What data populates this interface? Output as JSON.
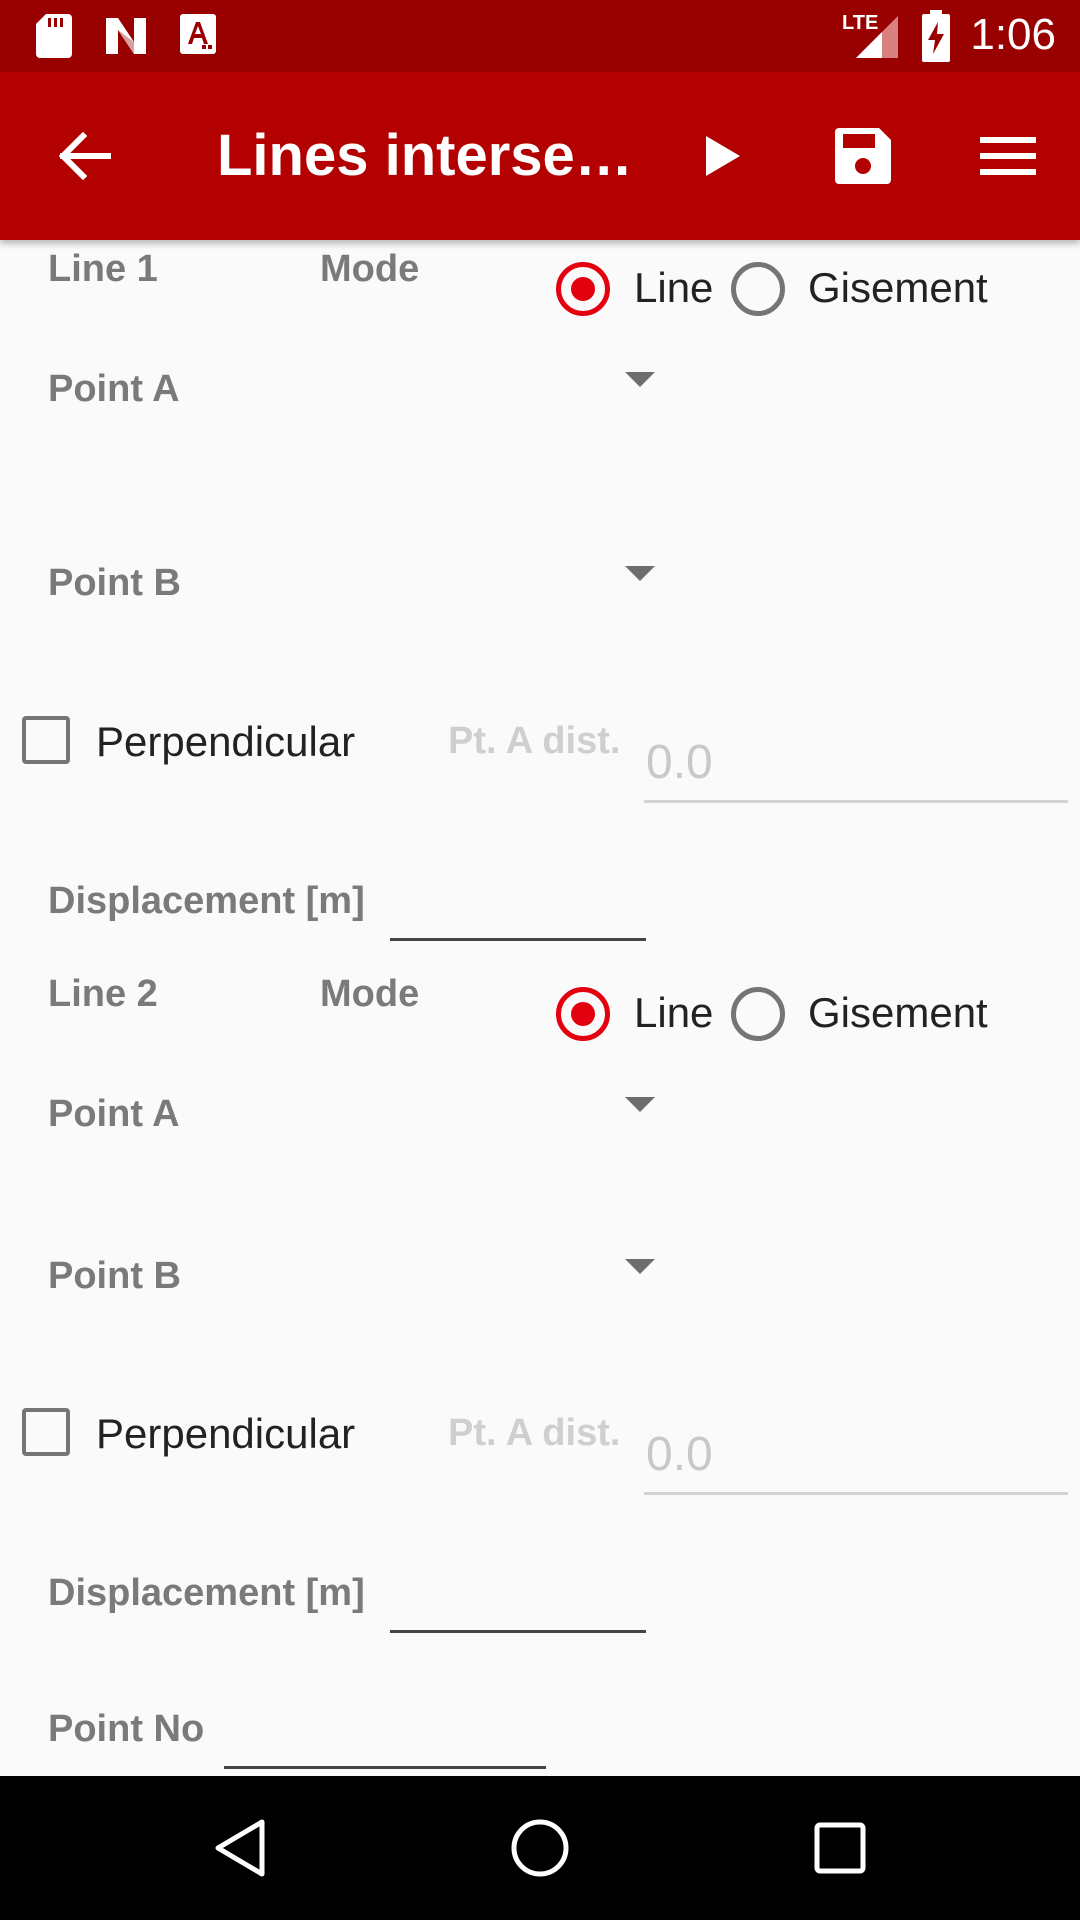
{
  "status_bar": {
    "time": "1:06",
    "network_label": "LTE",
    "icons": [
      "sd-card-icon",
      "n-notification-icon",
      "a-notification-icon",
      "lte-signal-icon",
      "battery-charging-icon"
    ]
  },
  "toolbar": {
    "title": "Lines interse…",
    "icons": [
      "back-arrow-icon",
      "play-icon",
      "save-icon",
      "menu-icon"
    ]
  },
  "form": {
    "line1": {
      "title": "Line 1",
      "mode_label": "Mode",
      "mode_options": [
        "Line",
        "Gisement"
      ],
      "mode_selected": "Line",
      "point_a_label": "Point A",
      "point_b_label": "Point B",
      "perpendicular_label": "Perpendicular",
      "perpendicular_checked": false,
      "pt_a_dist_label": "Pt. A dist.",
      "pt_a_dist_placeholder": "0.0",
      "displacement_label": "Displacement [m]",
      "displacement_value": ""
    },
    "line2": {
      "title": "Line 2",
      "mode_label": "Mode",
      "mode_options": [
        "Line",
        "Gisement"
      ],
      "mode_selected": "Line",
      "point_a_label": "Point A",
      "point_b_label": "Point B",
      "perpendicular_label": "Perpendicular",
      "perpendicular_checked": false,
      "pt_a_dist_label": "Pt. A dist.",
      "pt_a_dist_placeholder": "0.0",
      "displacement_label": "Displacement [m]",
      "displacement_value": ""
    },
    "point_no_label": "Point No",
    "point_no_value": ""
  },
  "colors": {
    "status_bar": "#990000",
    "toolbar": "#b30000",
    "accent": "#e3000f",
    "background": "#fafafa"
  },
  "nav_bar": {
    "icons": [
      "back-triangle-icon",
      "home-circle-icon",
      "recents-square-icon"
    ]
  }
}
